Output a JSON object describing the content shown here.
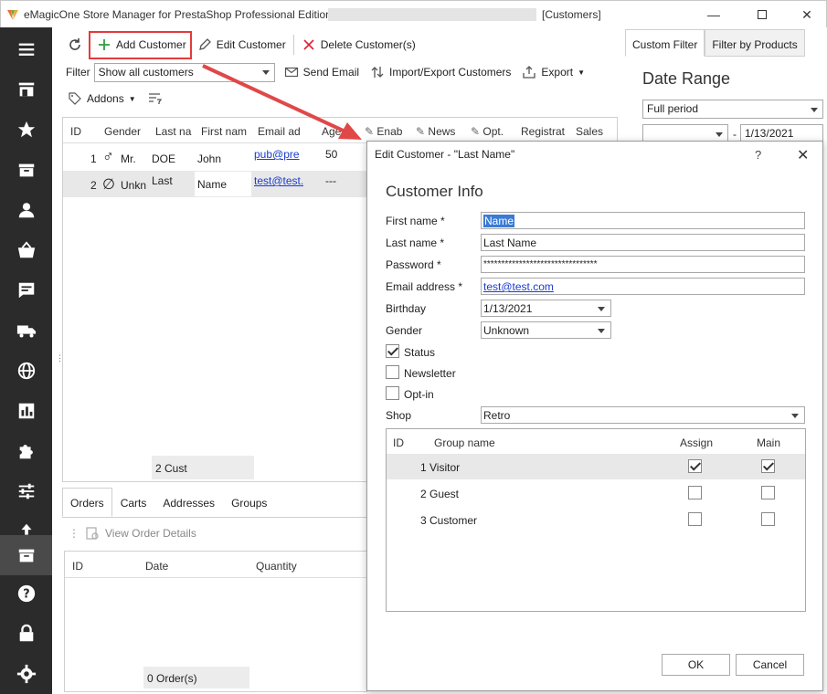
{
  "window": {
    "title": "eMagicOne Store Manager for PrestaShop Professional Edition |",
    "context": "[Customers]"
  },
  "toolbar": {
    "add_customer": "Add Customer",
    "edit_customer": "Edit Customer",
    "delete_customers": "Delete Customer(s)"
  },
  "filter": {
    "label": "Filter",
    "value": "Show all customers",
    "send_email": "Send Email",
    "import_export": "Import/Export Customers",
    "export": "Export"
  },
  "addons": {
    "label": "Addons"
  },
  "grid": {
    "headers": [
      "ID",
      "Gender",
      "Last na",
      "First nam",
      "Email ad",
      "Age",
      "Enab",
      "News",
      "Opt.",
      "Registrat",
      "Sales"
    ],
    "rows": [
      {
        "id": "1",
        "gender": "Mr.",
        "last": "DOE",
        "first": "John",
        "email": "pub@pre",
        "age": "50"
      },
      {
        "id": "2",
        "gender": "Unkn",
        "last": "Last",
        "first": "Name",
        "email": "test@test.",
        "age": "---"
      }
    ],
    "footer": "2 Cust"
  },
  "bottom_tabs": [
    "Orders",
    "Carts",
    "Addresses",
    "Groups"
  ],
  "orders": {
    "view_details": "View Order Details",
    "headers": [
      "ID",
      "Date",
      "Quantity"
    ],
    "footer": "0 Order(s)"
  },
  "right_panel": {
    "tabs": [
      "Custom Filter",
      "Filter by Products"
    ],
    "date_range_title": "Date Range",
    "period": "Full period",
    "date_from": "",
    "dash": "-",
    "date_to": "1/13/2021"
  },
  "dialog": {
    "title": "Edit Customer - \"Last Name\"",
    "help": "?",
    "heading": "Customer Info",
    "fields": {
      "first_name_label": "First name *",
      "first_name_value": "Name",
      "last_name_label": "Last name *",
      "last_name_value": "Last Name",
      "password_label": "Password *",
      "password_value": "********************************",
      "email_label": "Email address *",
      "email_value": "test@test.com",
      "birthday_label": "Birthday",
      "birthday_value": "1/13/2021",
      "gender_label": "Gender",
      "gender_value": "Unknown",
      "status_label": "Status",
      "newsletter_label": "Newsletter",
      "optin_label": "Opt-in",
      "shop_label": "Shop",
      "shop_value": "Retro"
    },
    "groups": {
      "headers": [
        "ID",
        "Group name",
        "Assign",
        "Main"
      ],
      "rows": [
        {
          "id": "1",
          "name": "Visitor",
          "assign": true,
          "main": true
        },
        {
          "id": "2",
          "name": "Guest",
          "assign": false,
          "main": false
        },
        {
          "id": "3",
          "name": "Customer",
          "assign": false,
          "main": false
        }
      ]
    },
    "ok": "OK",
    "cancel": "Cancel"
  },
  "colors": {
    "highlight": "#e23b3b",
    "nav_bg": "#2b2b2b",
    "link": "#1a3ccf",
    "selection": "#3a7bd5"
  }
}
